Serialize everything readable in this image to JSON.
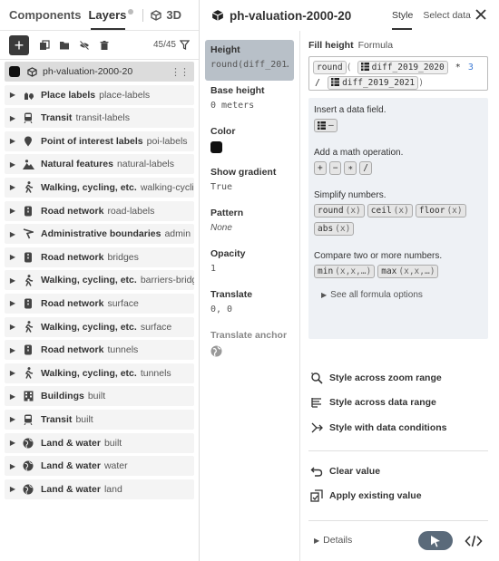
{
  "left": {
    "tabs": [
      {
        "label": "Components"
      },
      {
        "label": "Layers"
      },
      {
        "label": "3D"
      }
    ],
    "layer_count": "45/45",
    "layers": [
      {
        "group": "",
        "id": "ph-valuation-2000-20",
        "icon": "square-swatch",
        "selected": true
      },
      {
        "group": "Place labels",
        "id": "place-labels",
        "icon": "place-labels-icon"
      },
      {
        "group": "Transit",
        "id": "transit-labels",
        "icon": "transit-icon"
      },
      {
        "group": "Point of interest labels",
        "id": "poi-labels",
        "icon": "pin-icon"
      },
      {
        "group": "Natural features",
        "id": "natural-labels",
        "icon": "mountain-icon"
      },
      {
        "group": "Walking, cycling, etc.",
        "id": "walking-cycling-l",
        "icon": "walking-icon"
      },
      {
        "group": "Road network",
        "id": "road-labels",
        "icon": "road-icon"
      },
      {
        "group": "Administrative boundaries",
        "id": "admin",
        "icon": "flag-icon"
      },
      {
        "group": "Road network",
        "id": "bridges",
        "icon": "road-icon"
      },
      {
        "group": "Walking, cycling, etc.",
        "id": "barriers-bridges",
        "icon": "walking-icon"
      },
      {
        "group": "Road network",
        "id": "surface",
        "icon": "road-icon"
      },
      {
        "group": "Walking, cycling, etc.",
        "id": "surface",
        "icon": "walking-icon"
      },
      {
        "group": "Road network",
        "id": "tunnels",
        "icon": "road-icon"
      },
      {
        "group": "Walking, cycling, etc.",
        "id": "tunnels",
        "icon": "walking-icon"
      },
      {
        "group": "Buildings",
        "id": "built",
        "icon": "building-icon"
      },
      {
        "group": "Transit",
        "id": "built",
        "icon": "transit-icon"
      },
      {
        "group": "Land & water",
        "id": "built",
        "icon": "globe-icon"
      },
      {
        "group": "Land & water",
        "id": "water",
        "icon": "globe-icon"
      },
      {
        "group": "Land & water",
        "id": "land",
        "icon": "globe-icon"
      }
    ]
  },
  "right": {
    "title": "ph-valuation-2000-20",
    "tabs": [
      {
        "label": "Style"
      },
      {
        "label": "Select data"
      }
    ],
    "properties": [
      {
        "label": "Height",
        "value": "round(diff_201…",
        "active": true
      },
      {
        "label": "Base height",
        "value": "0 meters"
      },
      {
        "label": "Color",
        "value": ""
      },
      {
        "label": "Show gradient",
        "value": "True"
      },
      {
        "label": "Pattern",
        "value": "None"
      },
      {
        "label": "Opacity",
        "value": "1"
      },
      {
        "label": "Translate",
        "value": "0, 0"
      },
      {
        "label": "Translate anchor",
        "value": ""
      }
    ],
    "editor": {
      "title": "Fill height",
      "mode": "Formula",
      "formula": {
        "fn": "round",
        "field1": "diff_2019_2020",
        "op1": "*",
        "num": "3",
        "op2": "/",
        "field2": "diff_2019_2021"
      },
      "help": {
        "insert_text": "Insert a data field.",
        "insert_btn": "–",
        "math_text": "Add a math operation.",
        "math_ops": [
          "+",
          "−",
          "∗",
          "/"
        ],
        "simplify_text": "Simplify numbers.",
        "simplify_fns": [
          {
            "fn": "round",
            "arg": "(x)"
          },
          {
            "fn": "ceil",
            "arg": "(x)"
          },
          {
            "fn": "floor",
            "arg": "(x)"
          }
        ],
        "abs_fn": {
          "fn": "abs",
          "arg": "(x)"
        },
        "compare_text": "Compare two or more numbers.",
        "compare_fns": [
          {
            "fn": "min",
            "arg": "(x,x,…)"
          },
          {
            "fn": "max",
            "arg": "(x,x,…)"
          }
        ],
        "more": "See all formula options"
      },
      "options": [
        {
          "label": "Style across zoom range",
          "icon": "zoom-range-icon"
        },
        {
          "label": "Style across data range",
          "icon": "data-range-icon"
        },
        {
          "label": "Style with data conditions",
          "icon": "data-conditions-icon"
        }
      ],
      "actions": [
        {
          "label": "Clear value",
          "icon": "undo-icon"
        },
        {
          "label": "Apply existing value",
          "icon": "apply-existing-icon"
        }
      ],
      "details": "Details"
    }
  }
}
